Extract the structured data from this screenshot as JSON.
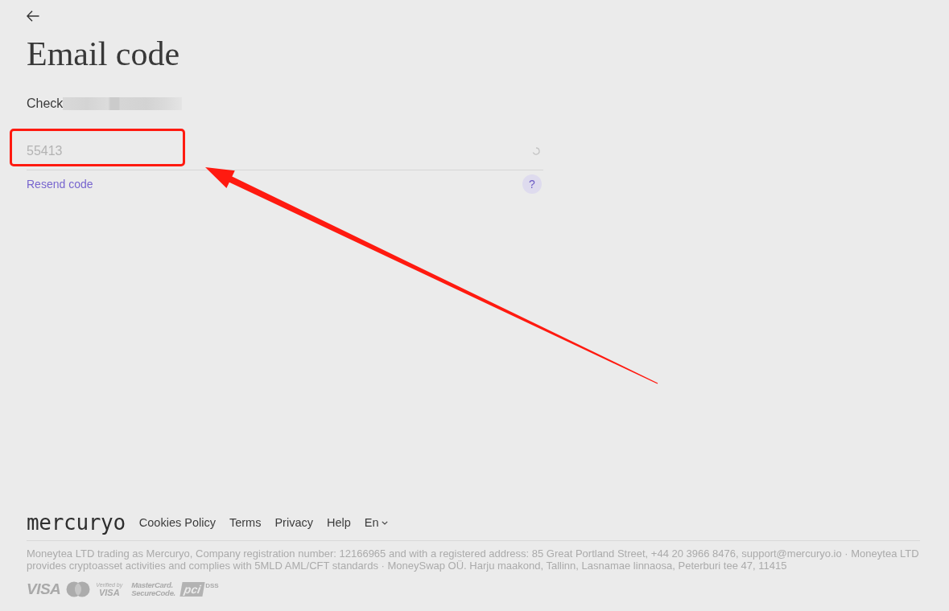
{
  "title": "Email code",
  "instruction": {
    "label": "Check",
    "email_redacted": true
  },
  "code_field": {
    "value": "55413",
    "disabled": true,
    "loading": true
  },
  "resend_link": "Resend code",
  "help_button": "?",
  "annotations": {
    "highlight_box": true,
    "arrow": true
  },
  "footer": {
    "logo": "mercuryo",
    "links": [
      "Cookies Policy",
      "Terms",
      "Privacy",
      "Help"
    ],
    "language": "En",
    "legal": "Moneytea LTD trading as Mercuryo, Company registration number: 12166965 and with a registered address: 85 Great Portland Street, +44 20 3966 8476, support@mercuryo.io · Moneytea LTD provides cryptoasset activities and complies with 5MLD AML/CFT standards · MoneySwap OÜ. Harju maakond, Tallinn, Lasnamae linnaosa, Peterburi tee 47, 11415",
    "payment_logos": [
      {
        "kind": "visa",
        "lines": [
          "VISA"
        ]
      },
      {
        "kind": "mastercard"
      },
      {
        "kind": "verified",
        "lines": [
          "Verified by",
          "VISA"
        ]
      },
      {
        "kind": "securecode",
        "lines": [
          "MasterCard.",
          "SecureCode."
        ]
      },
      {
        "kind": "pci",
        "lines": [
          "pci",
          "DSS"
        ]
      }
    ]
  }
}
